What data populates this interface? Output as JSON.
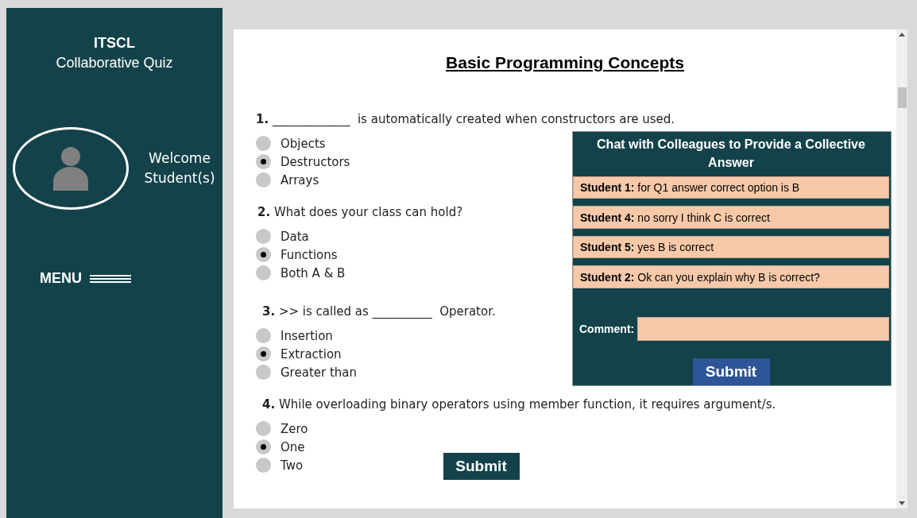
{
  "sidebar": {
    "brand": "ITSCL",
    "subtitle": "Collaborative Quiz",
    "welcome": "Welcome Student(s)",
    "menu": "MENU"
  },
  "quiz": {
    "title": "Basic Programming Concepts",
    "questions": [
      {
        "text": "**1.** _____________  is automatically created when constructors are used.",
        "options": [
          {
            "label": "Objects",
            "selected": false
          },
          {
            "label": "Destructors",
            "selected": true
          },
          {
            "label": "Arrays",
            "selected": false
          }
        ]
      },
      {
        "text": "**2.** What does your class can hold?",
        "options": [
          {
            "label": "Data",
            "selected": false
          },
          {
            "label": "Functions",
            "selected": true
          },
          {
            "label": "Both A & B",
            "selected": false
          }
        ]
      },
      {
        "text": "**3.** >> is called as __________  Operator.",
        "options": [
          {
            "label": "Insertion",
            "selected": false
          },
          {
            "label": "Extraction",
            "selected": true
          },
          {
            "label": "Greater than",
            "selected": false
          }
        ]
      },
      {
        "text": "**4.** While overloading binary operators using member function, it requires argument/s.",
        "options": [
          {
            "label": "Zero",
            "selected": false
          },
          {
            "label": "One",
            "selected": true
          },
          {
            "label": "Two",
            "selected": false
          }
        ]
      }
    ],
    "submit": "Submit"
  },
  "chat": {
    "title": "Chat with Colleagues to Provide a Collective Answer",
    "messages": [
      {
        "text": "**Student 1:** for Q1 answer correct option is B"
      },
      {
        "text": "**Student 4:** no sorry I think C is correct"
      },
      {
        "text": "**Student 5:** yes B is correct"
      },
      {
        "text": "**Student 2:** Ok can you explain why B is correct?"
      }
    ],
    "comment_label": "Comment:",
    "submit": "Submit"
  }
}
